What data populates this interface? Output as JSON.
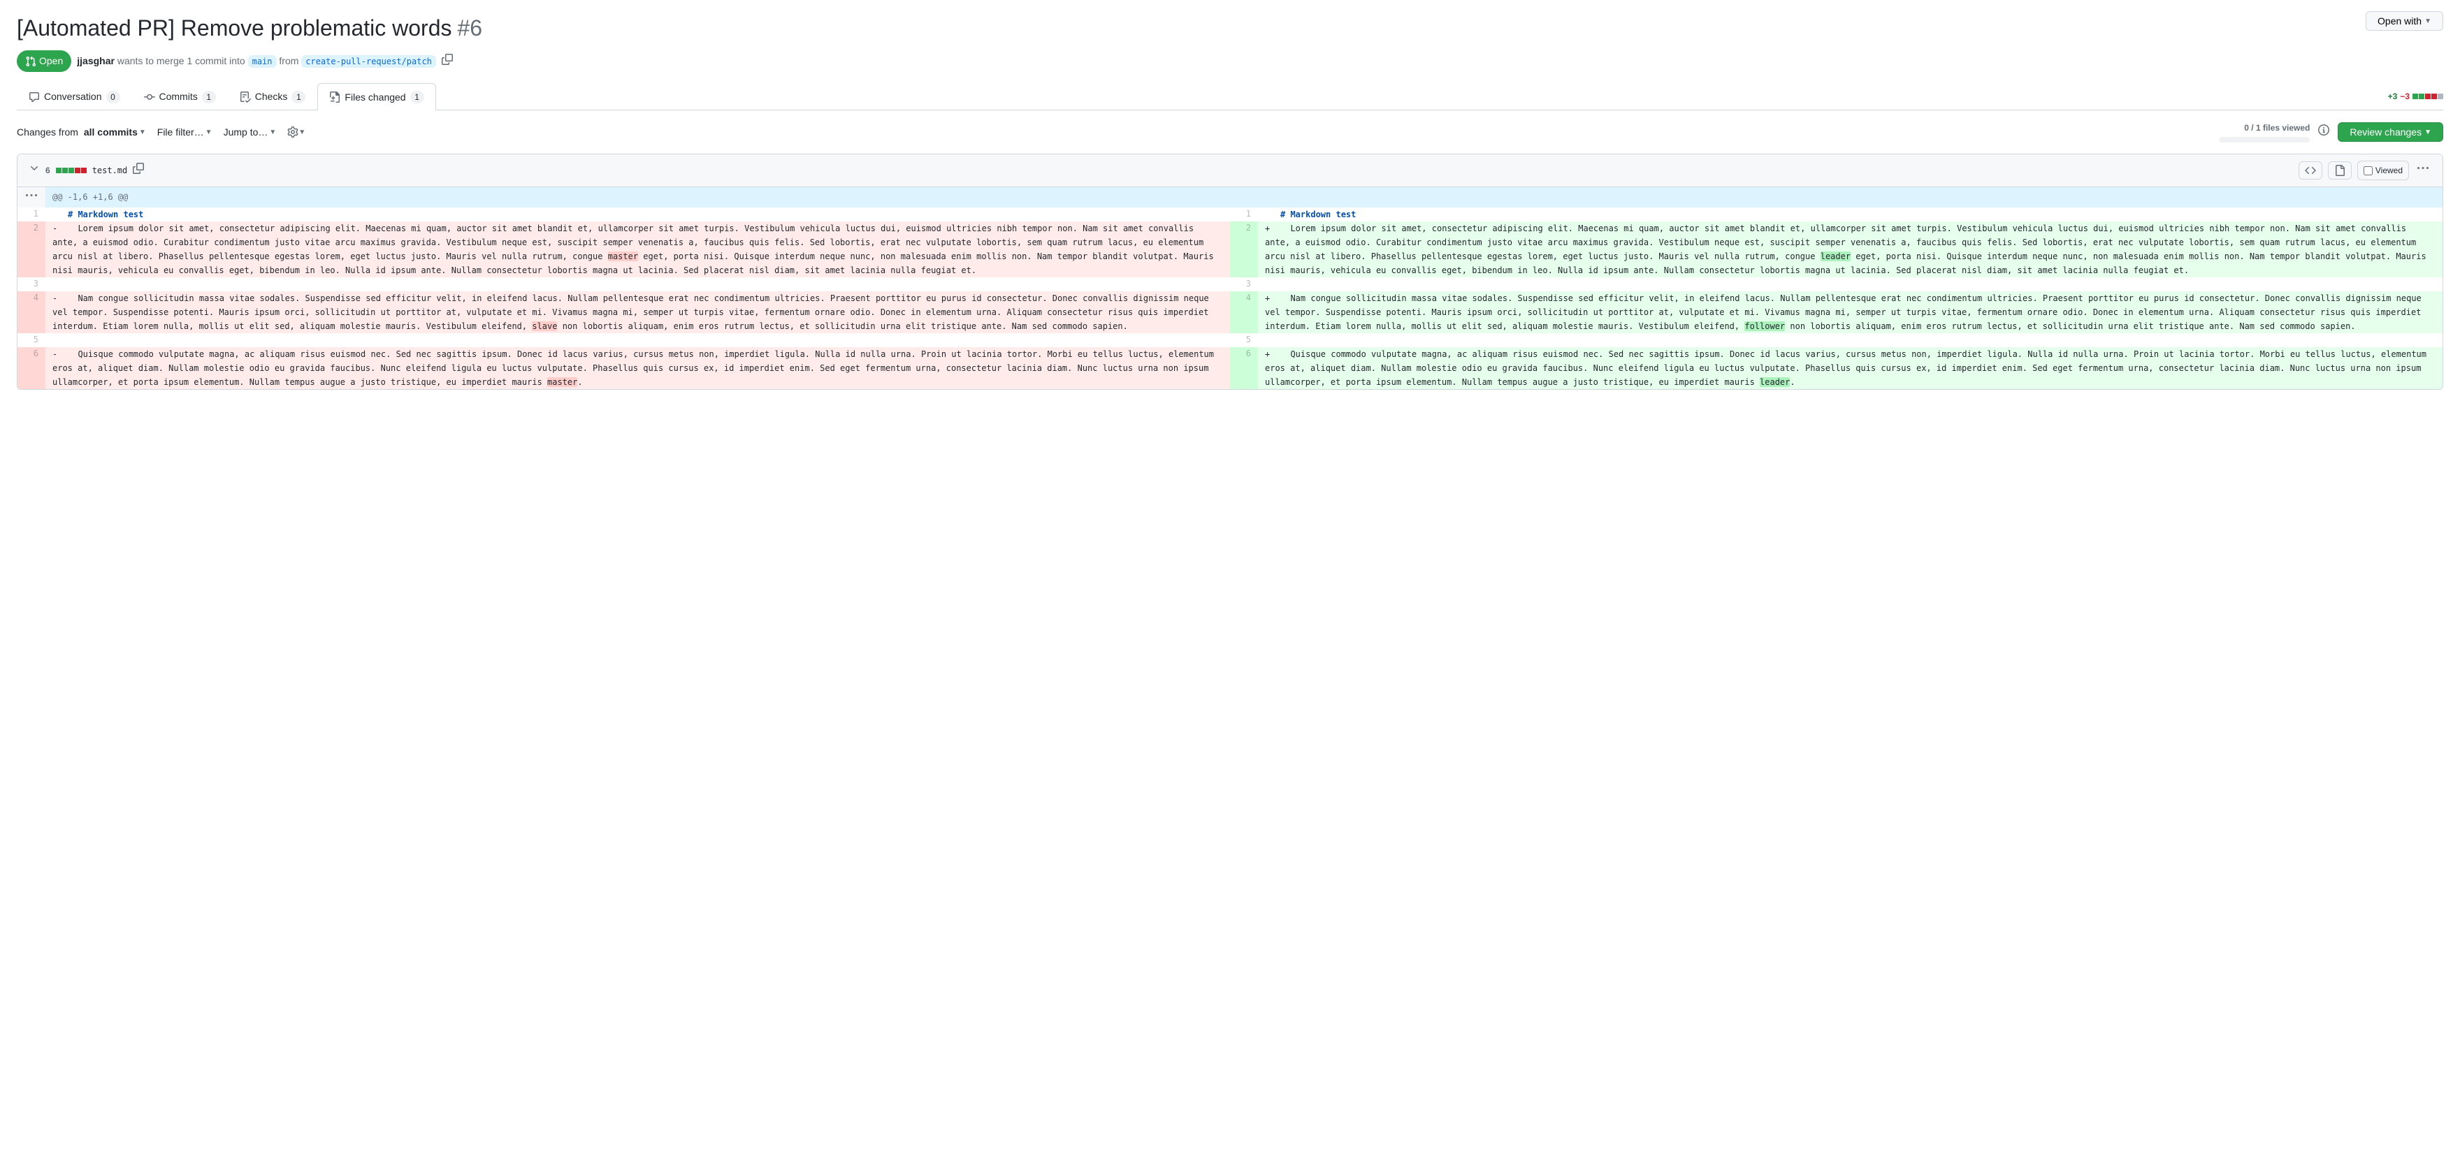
{
  "pr": {
    "title": "[Automated PR] Remove problematic words",
    "number": "#6",
    "state": "Open",
    "author": "jjasghar",
    "merge_text_prefix": "wants to merge 1 commit into",
    "base_branch": "main",
    "from_text": "from",
    "head_branch": "create-pull-request/patch"
  },
  "open_with_label": "Open with",
  "tabs": {
    "conversation": {
      "label": "Conversation",
      "count": "0"
    },
    "commits": {
      "label": "Commits",
      "count": "1"
    },
    "checks": {
      "label": "Checks",
      "count": "1"
    },
    "files_changed": {
      "label": "Files changed",
      "count": "1"
    }
  },
  "diffstat": {
    "added": "+3",
    "removed": "−3"
  },
  "toolbar": {
    "changes_from_prefix": "Changes from",
    "changes_from_value": "all commits",
    "file_filter": "File filter…",
    "jump_to": "Jump to…",
    "files_viewed": "0 / 1 files viewed",
    "review_changes": "Review changes"
  },
  "file": {
    "changes": "6",
    "name": "test.md",
    "viewed_label": "Viewed"
  },
  "hunk": "@@ -1,6 +1,6 @@",
  "diff": {
    "left": [
      {
        "type": "ctx",
        "num": "1",
        "marker": "",
        "html": "<span class='md-heading'># Markdown test</span>"
      },
      {
        "type": "del",
        "num": "2",
        "marker": "-",
        "html": "  Lorem ipsum dolor sit amet, consectetur adipiscing elit. Maecenas mi quam, auctor sit amet blandit et, ullamcorper sit amet turpis. Vestibulum vehicula luctus dui, euismod ultricies nibh tempor non. Nam sit amet convallis ante, a euismod odio. Curabitur condimentum justo vitae arcu maximus gravida. Vestibulum neque est, suscipit semper venenatis a, faucibus quis felis. Sed lobortis, erat nec vulputate lobortis, sem quam rutrum lacus, eu elementum arcu nisl at libero. Phasellus pellentesque egestas lorem, eget luctus justo. Mauris vel nulla rutrum, congue <span class='hl-del'>master</span> eget, porta nisi. Quisque interdum neque nunc, non malesuada enim mollis non. Nam tempor blandit volutpat. Mauris nisi mauris, vehicula eu convallis eget, bibendum in leo. Nulla id ipsum ante. Nullam consectetur lobortis magna ut lacinia. Sed placerat nisl diam, sit amet lacinia nulla feugiat et."
      },
      {
        "type": "ctx",
        "num": "3",
        "marker": "",
        "html": ""
      },
      {
        "type": "del",
        "num": "4",
        "marker": "-",
        "html": "  Nam congue sollicitudin massa vitae sodales. Suspendisse sed efficitur velit, in eleifend lacus. Nullam pellentesque erat nec condimentum ultricies. Praesent porttitor eu purus id consectetur. Donec convallis dignissim neque vel tempor. Suspendisse potenti. Mauris ipsum orci, sollicitudin ut porttitor at, vulputate et mi. Vivamus magna mi, semper ut turpis vitae, fermentum ornare odio. Donec in elementum urna. Aliquam consectetur risus quis imperdiet interdum. Etiam lorem nulla, mollis ut elit sed, aliquam molestie mauris. Vestibulum eleifend, <span class='hl-del'>slave</span> non lobortis aliquam, enim eros rutrum lectus, et sollicitudin urna elit tristique ante. Nam sed commodo sapien."
      },
      {
        "type": "ctx",
        "num": "5",
        "marker": "",
        "html": ""
      },
      {
        "type": "del",
        "num": "6",
        "marker": "-",
        "html": "  Quisque commodo vulputate magna, ac aliquam risus euismod nec. Sed nec sagittis ipsum. Donec id lacus varius, cursus metus non, imperdiet ligula. Nulla id nulla urna. Proin ut lacinia tortor. Morbi eu tellus luctus, elementum eros at, aliquet diam. Nullam molestie odio eu gravida faucibus. Nunc eleifend ligula eu luctus vulputate. Phasellus quis cursus ex, id imperdiet enim. Sed eget fermentum urna, consectetur lacinia diam. Nunc luctus urna non ipsum ullamcorper, et porta ipsum elementum. Nullam tempus augue a justo tristique, eu imperdiet mauris <span class='hl-del'>master</span>."
      }
    ],
    "right": [
      {
        "type": "ctx",
        "num": "1",
        "marker": "",
        "html": "<span class='md-heading'># Markdown test</span>"
      },
      {
        "type": "add",
        "num": "2",
        "marker": "+",
        "html": "  Lorem ipsum dolor sit amet, consectetur adipiscing elit. Maecenas mi quam, auctor sit amet blandit et, ullamcorper sit amet turpis. Vestibulum vehicula luctus dui, euismod ultricies nibh tempor non. Nam sit amet convallis ante, a euismod odio. Curabitur condimentum justo vitae arcu maximus gravida. Vestibulum neque est, suscipit semper venenatis a, faucibus quis felis. Sed lobortis, erat nec vulputate lobortis, sem quam rutrum lacus, eu elementum arcu nisl at libero. Phasellus pellentesque egestas lorem, eget luctus justo. Mauris vel nulla rutrum, congue <span class='hl-add'>leader</span> eget, porta nisi. Quisque interdum neque nunc, non malesuada enim mollis non. Nam tempor blandit volutpat. Mauris nisi mauris, vehicula eu convallis eget, bibendum in leo. Nulla id ipsum ante. Nullam consectetur lobortis magna ut lacinia. Sed placerat nisl diam, sit amet lacinia nulla feugiat et."
      },
      {
        "type": "ctx",
        "num": "3",
        "marker": "",
        "html": ""
      },
      {
        "type": "add",
        "num": "4",
        "marker": "+",
        "html": "  Nam congue sollicitudin massa vitae sodales. Suspendisse sed efficitur velit, in eleifend lacus. Nullam pellentesque erat nec condimentum ultricies. Praesent porttitor eu purus id consectetur. Donec convallis dignissim neque vel tempor. Suspendisse potenti. Mauris ipsum orci, sollicitudin ut porttitor at, vulputate et mi. Vivamus magna mi, semper ut turpis vitae, fermentum ornare odio. Donec in elementum urna. Aliquam consectetur risus quis imperdiet interdum. Etiam lorem nulla, mollis ut elit sed, aliquam molestie mauris. Vestibulum eleifend, <span class='hl-add'>follower</span> non lobortis aliquam, enim eros rutrum lectus, et sollicitudin urna elit tristique ante. Nam sed commodo sapien."
      },
      {
        "type": "ctx",
        "num": "5",
        "marker": "",
        "html": ""
      },
      {
        "type": "add",
        "num": "6",
        "marker": "+",
        "html": "  Quisque commodo vulputate magna, ac aliquam risus euismod nec. Sed nec sagittis ipsum. Donec id lacus varius, cursus metus non, imperdiet ligula. Nulla id nulla urna. Proin ut lacinia tortor. Morbi eu tellus luctus, elementum eros at, aliquet diam. Nullam molestie odio eu gravida faucibus. Nunc eleifend ligula eu luctus vulputate. Phasellus quis cursus ex, id imperdiet enim. Sed eget fermentum urna, consectetur lacinia diam. Nunc luctus urna non ipsum ullamcorper, et porta ipsum elementum. Nullam tempus augue a justo tristique, eu imperdiet mauris <span class='hl-add'>leader</span>."
      }
    ]
  }
}
